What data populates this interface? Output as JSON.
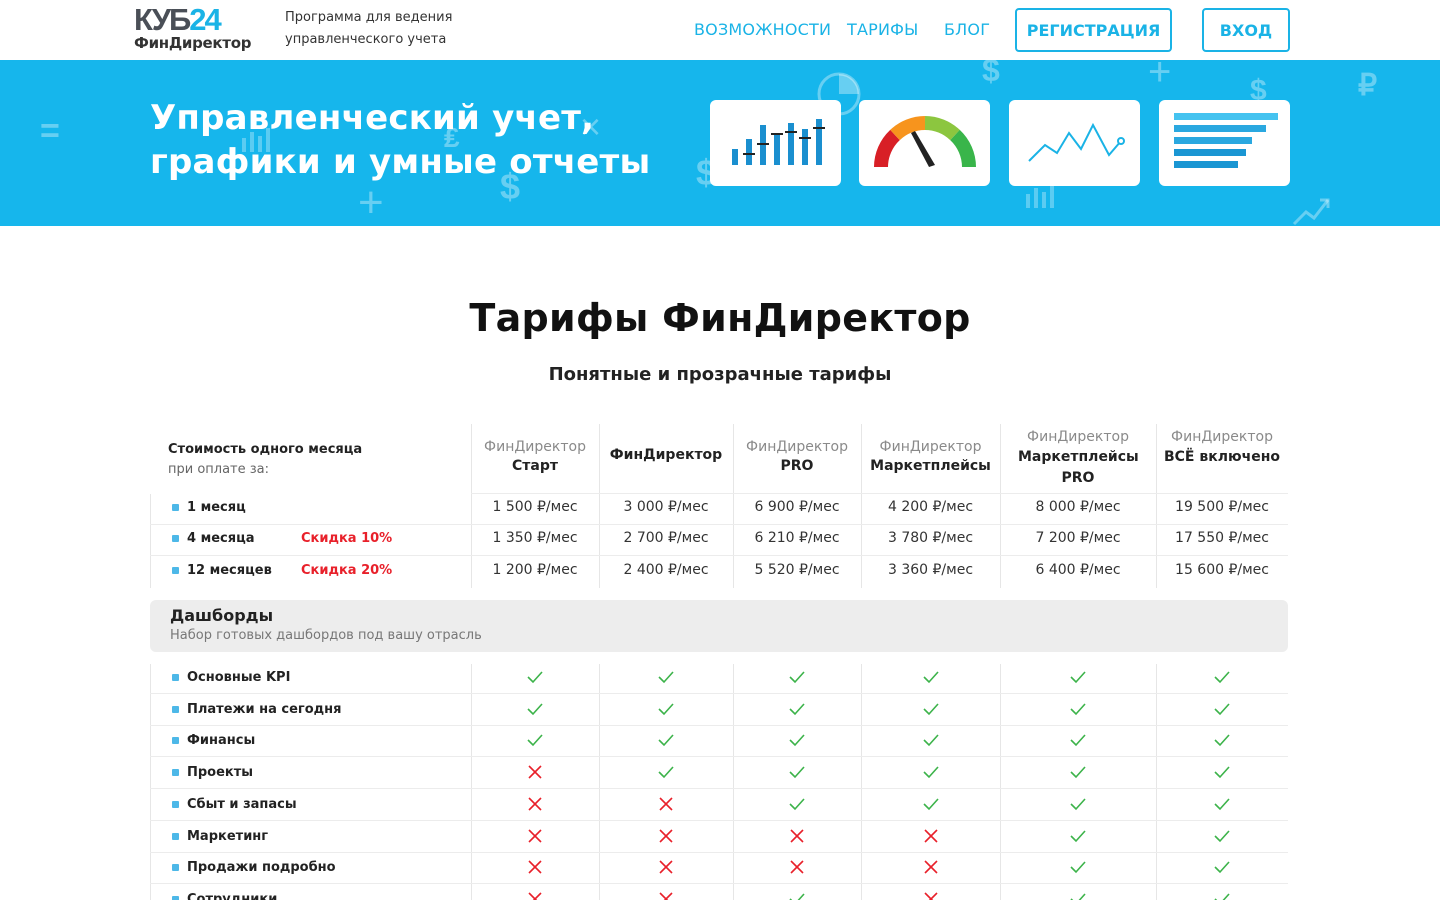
{
  "header": {
    "logo_top_letters": "КУБ",
    "logo_top_num": "24",
    "logo_bottom": "ФинДиректор",
    "tagline": "Программа для ведения управленческого учета",
    "nav": [
      {
        "label": "ВОЗМОЖНОСТИ"
      },
      {
        "label": "ТАРИФЫ"
      },
      {
        "label": "БЛОГ"
      }
    ],
    "register_label": "РЕГИСТРАЦИЯ",
    "login_label": "ВХОД"
  },
  "hero": {
    "title_line1": "Управленческий учет,",
    "title_line2": "графики и умные отчеты",
    "cards": [
      "bar-chart-icon",
      "gauge-icon",
      "line-chart-icon",
      "horizontal-bars-icon"
    ]
  },
  "pricing": {
    "title": "Тарифы ФинДиректор",
    "subtitle": "Понятные и прозрачные тарифы",
    "cost_label": "Стоимость одного месяца",
    "cost_sub": "при оплате за:",
    "plans": [
      {
        "pre": "ФинДиректор",
        "name": "Старт"
      },
      {
        "pre": "",
        "name": "ФинДиректор"
      },
      {
        "pre": "ФинДиректор",
        "name": "PRO"
      },
      {
        "pre": "ФинДиректор",
        "name": "Маркетплейсы"
      },
      {
        "pre": "ФинДиректор",
        "name": "Маркетплейсы PRO"
      },
      {
        "pre": "ФинДиректор",
        "name": "ВСЁ включено"
      }
    ],
    "rows": [
      {
        "label": "1 месяц",
        "discount": "",
        "prices": [
          "1 500 ₽/мес",
          "3 000 ₽/мес",
          "6 900 ₽/мес",
          "4 200 ₽/мес",
          "8 000 ₽/мес",
          "19 500 ₽/мес"
        ]
      },
      {
        "label": "4 месяца",
        "discount": "Скидка 10%",
        "prices": [
          "1 350 ₽/мес",
          "2 700 ₽/мес",
          "6 210 ₽/мес",
          "3 780 ₽/мес",
          "7 200 ₽/мес",
          "17 550 ₽/мес"
        ]
      },
      {
        "label": "12 месяцев",
        "discount": "Скидка 20%",
        "prices": [
          "1 200 ₽/мес",
          "2 400 ₽/мес",
          "5 520 ₽/мес",
          "3 360 ₽/мес",
          "6 400 ₽/мес",
          "15 600 ₽/мес"
        ]
      }
    ]
  },
  "dashboards": {
    "title": "Дашборды",
    "description": "Набор готовых дашбордов под вашу отрасль",
    "features": [
      {
        "label": "Основные KPI",
        "marks": [
          1,
          1,
          1,
          1,
          1,
          1
        ]
      },
      {
        "label": "Платежи на сегодня",
        "marks": [
          1,
          1,
          1,
          1,
          1,
          1
        ]
      },
      {
        "label": "Финансы",
        "marks": [
          1,
          1,
          1,
          1,
          1,
          1
        ]
      },
      {
        "label": "Проекты",
        "marks": [
          0,
          1,
          1,
          1,
          1,
          1
        ]
      },
      {
        "label": "Сбыт и запасы",
        "marks": [
          0,
          0,
          1,
          1,
          1,
          1
        ]
      },
      {
        "label": "Маркетинг",
        "marks": [
          0,
          0,
          0,
          0,
          1,
          1
        ]
      },
      {
        "label": "Продажи подробно",
        "marks": [
          0,
          0,
          0,
          0,
          1,
          1
        ]
      },
      {
        "label": "Сотрудники",
        "marks": [
          0,
          0,
          1,
          0,
          1,
          1
        ]
      }
    ]
  },
  "colors": {
    "accent": "#16b6ec",
    "check": "#3cb34a",
    "cross": "#e8202a"
  }
}
